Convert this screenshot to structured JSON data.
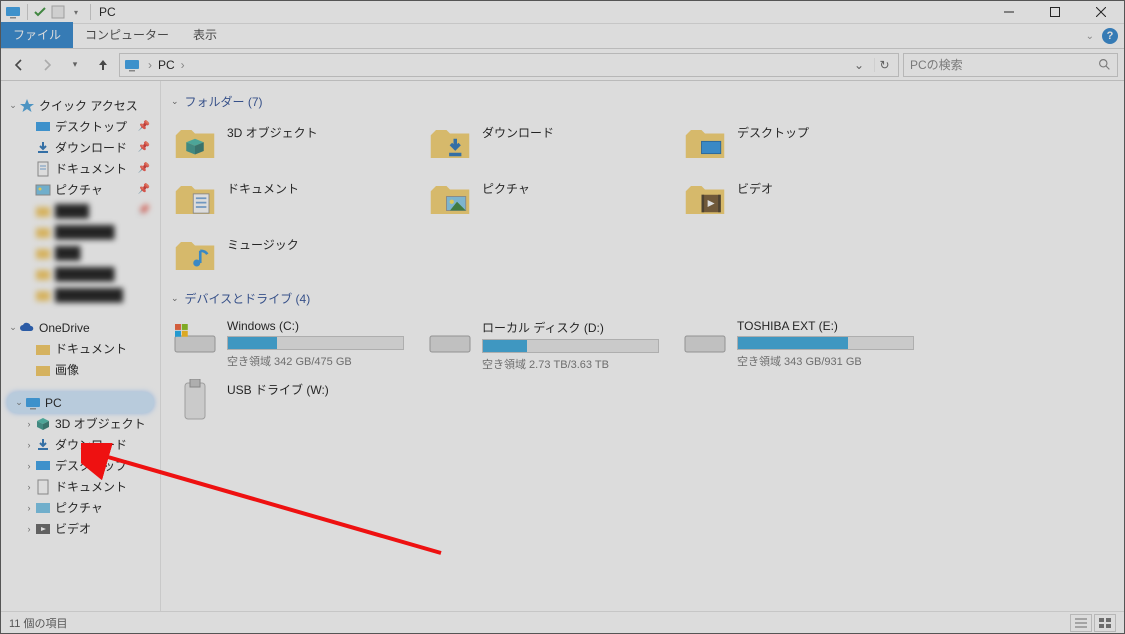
{
  "window": {
    "title": "PC"
  },
  "ribbon": {
    "tabs": {
      "file": "ファイル",
      "computer": "コンピューター",
      "view": "表示"
    }
  },
  "nav": {
    "location": "PC",
    "search_placeholder": "PCの検索"
  },
  "sidebar": {
    "quick_access": "クイック アクセス",
    "qa_items": [
      {
        "label": "デスクトップ"
      },
      {
        "label": "ダウンロード"
      },
      {
        "label": "ドキュメント"
      },
      {
        "label": "ピクチャ"
      }
    ],
    "onedrive": "OneDrive",
    "od_items": [
      {
        "label": "ドキュメント"
      },
      {
        "label": "画像"
      }
    ],
    "pc": "PC",
    "pc_items": [
      {
        "label": "3D オブジェクト"
      },
      {
        "label": "ダウンロード"
      },
      {
        "label": "デスクトップ"
      },
      {
        "label": "ドキュメント"
      },
      {
        "label": "ピクチャ"
      },
      {
        "label": "ビデオ"
      }
    ]
  },
  "content": {
    "group_folders": "フォルダー (7)",
    "folders": [
      {
        "label": "3D オブジェクト"
      },
      {
        "label": "ダウンロード"
      },
      {
        "label": "デスクトップ"
      },
      {
        "label": "ドキュメント"
      },
      {
        "label": "ピクチャ"
      },
      {
        "label": "ビデオ"
      },
      {
        "label": "ミュージック"
      }
    ],
    "group_drives": "デバイスとドライブ (4)",
    "drives": [
      {
        "name": "Windows (C:)",
        "free": "空き領域 342 GB/475 GB",
        "fill": 28
      },
      {
        "name": "ローカル ディスク (D:)",
        "free": "空き領域 2.73 TB/3.63 TB",
        "fill": 25
      },
      {
        "name": "TOSHIBA EXT (E:)",
        "free": "空き領域 343 GB/931 GB",
        "fill": 63
      },
      {
        "name": "USB ドライブ (W:)",
        "free": "",
        "fill": -1
      }
    ]
  },
  "status": {
    "count": "11 個の項目"
  }
}
